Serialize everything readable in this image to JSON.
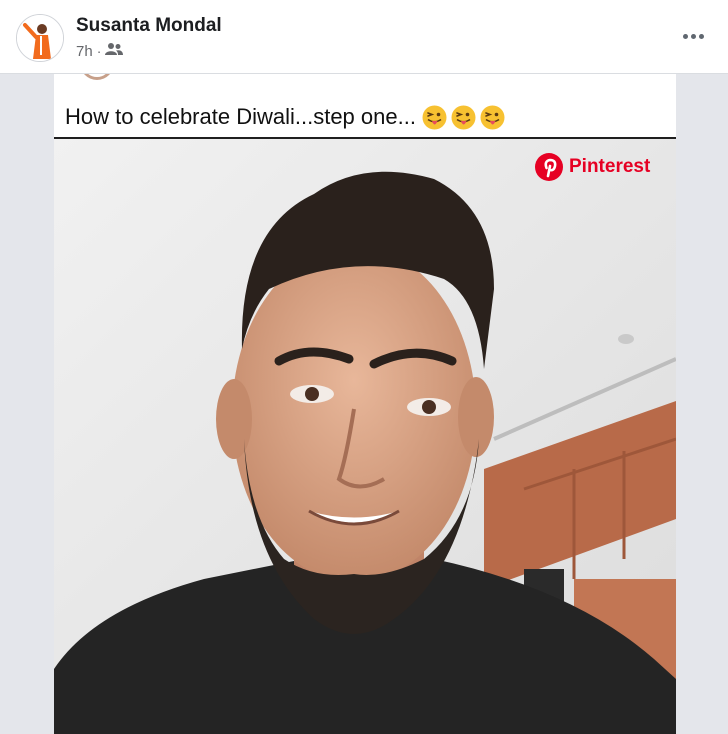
{
  "post": {
    "author": "Susanta Mondal",
    "time": "7h",
    "separator": "·",
    "audience_icon": "friends-icon",
    "more_icon": "more-options-icon"
  },
  "image": {
    "caption": "How to celebrate Diwali...step one...",
    "caption_emoji": [
      "tongue-out-emoji",
      "tongue-out-emoji",
      "tongue-out-emoji"
    ],
    "watermark": "Pinterest",
    "watermark_color": "#e60023"
  }
}
